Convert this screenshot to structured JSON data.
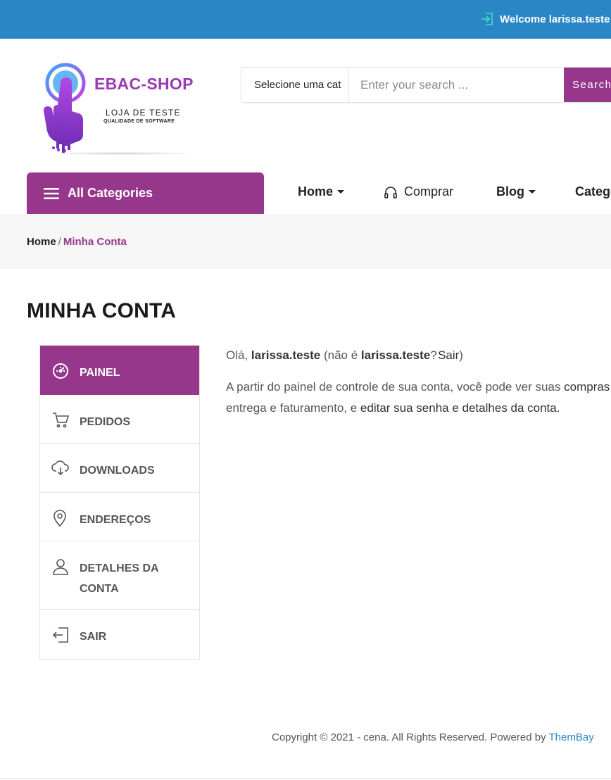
{
  "topbar": {
    "welcome": "Welcome larissa.teste"
  },
  "logo": {
    "title": "EBAC-SHOP",
    "subtitle": "LOJA DE TESTE",
    "tagline": "QUALIDADE DE SOFTWARE"
  },
  "search": {
    "category": "Selecione uma cat",
    "placeholder": "Enter your search ...",
    "button": "Search"
  },
  "nav": {
    "all_categories": "All Categories",
    "items": [
      {
        "label": "Home"
      },
      {
        "label": "Comprar"
      },
      {
        "label": "Blog"
      },
      {
        "label": "Catego"
      }
    ]
  },
  "breadcrumb": {
    "home": "Home",
    "separator": "/",
    "current": "Minha Conta"
  },
  "page": {
    "title": "MINHA CONTA"
  },
  "account_nav": {
    "items": [
      {
        "label": "PAINEL",
        "icon": "dashboard-icon"
      },
      {
        "label": "PEDIDOS",
        "icon": "cart-icon"
      },
      {
        "label": "DOWNLOADS",
        "icon": "cloud-download-icon"
      },
      {
        "label": "ENDEREÇOS",
        "icon": "location-pin-icon"
      },
      {
        "label": "DETALHES DA CONTA",
        "icon": "user-icon"
      },
      {
        "label": "SAIR",
        "icon": "logout-icon"
      }
    ]
  },
  "content": {
    "greeting_prefix": "Olá,",
    "user": "larissa.teste",
    "not_user_prefix": "(não é",
    "logout_link": "Sair",
    "intro_a": "A partir do painel de controle de sua conta, você pode ver suas",
    "link_orders": "compras r",
    "intro_b": "entrega e faturamento, e",
    "link_edit": "editar sua senha e detalhes da conta."
  },
  "footer": {
    "text": "Copyright © 2021 - cena. All Rights Reserved. Powered by",
    "brand": "ThemBay"
  },
  "colors": {
    "topbar": "#2b86c5",
    "accent": "#96378b",
    "crumb_bg": "#f6f6f6"
  }
}
